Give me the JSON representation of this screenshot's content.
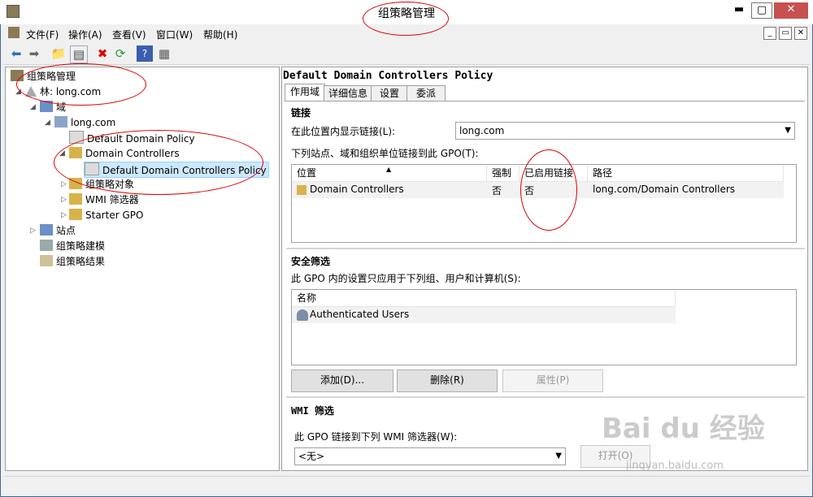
{
  "window": {
    "title": "组策略管理",
    "min": "▬",
    "max": "▢",
    "close": "✕"
  },
  "menu": [
    "文件(F)",
    "操作(A)",
    "查看(V)",
    "窗口(W)",
    "帮助(H)"
  ],
  "tree": {
    "root": "组策略管理",
    "forest": "林: long.com",
    "domains": "域",
    "domain": "long.com",
    "ddp": "Default Domain Policy",
    "dc": "Domain Controllers",
    "dcp": "Default Domain Controllers Policy",
    "gpo_objects": "组策略对象",
    "wmi": "WMI 筛选器",
    "starter": "Starter GPO",
    "sites": "站点",
    "modeling": "组策略建模",
    "results": "组策略结果"
  },
  "right": {
    "title": "Default Domain Controllers Policy",
    "tabs": [
      "作用域",
      "详细信息",
      "设置",
      "委派"
    ],
    "links": {
      "heading": "链接",
      "show_label": "在此位置内显示链接(L):",
      "show_value": "long.com",
      "list_label": "下列站点、域和组织单位链接到此 GPO(T):",
      "columns": [
        "位置",
        "强制",
        "已启用链接",
        "路径"
      ],
      "rows": [
        {
          "location": "Domain Controllers",
          "enforced": "否",
          "enabled": "否",
          "path": "long.com/Domain Controllers"
        }
      ]
    },
    "security": {
      "heading": "安全筛选",
      "desc": "此 GPO 内的设置只应用于下列组、用户和计算机(S):",
      "column": "名称",
      "items": [
        "Authenticated Users"
      ],
      "add": "添加(D)...",
      "remove": "删除(R)",
      "props": "属性(P)"
    },
    "wmi": {
      "heading": "WMI 筛选",
      "desc": "此 GPO 链接到下列 WMI 筛选器(W):",
      "value": "<无>",
      "open": "打开(O)"
    }
  },
  "watermark": {
    "main": "Bai du 经验",
    "sub": "jingyan.baidu.com"
  }
}
